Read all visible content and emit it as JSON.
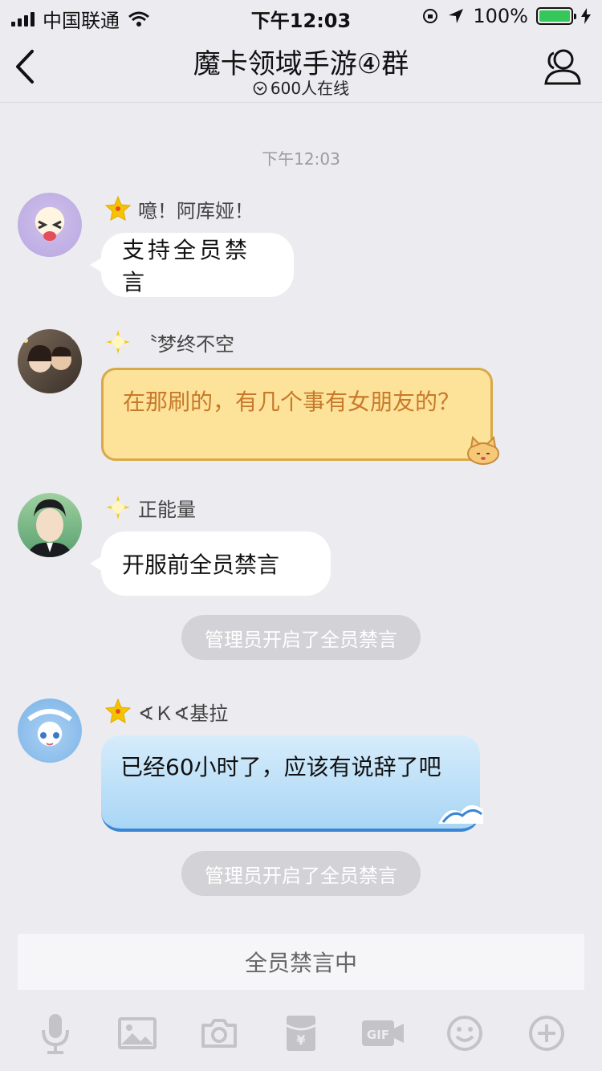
{
  "status": {
    "carrier": "中国联通",
    "time": "下午12:03",
    "battery": "100%"
  },
  "nav": {
    "title": "魔卡领域手游④群",
    "online": "600人在线"
  },
  "chat": {
    "time_label": "下午12:03",
    "messages": [
      {
        "nick": "噫！阿库娅！",
        "text": "支持全员禁言"
      },
      {
        "nick": "〝梦终不空",
        "text": "在那刷的，有几个事有女朋友的？"
      },
      {
        "nick": "正能量",
        "text": "开服前全员禁言"
      },
      {
        "nick": "∢Ｋ∢基拉",
        "text": "已经60小时了，应该有说辞了吧"
      }
    ],
    "system": [
      "管理员开启了全员禁言",
      "管理员开启了全员禁言"
    ]
  },
  "muted_label": "全员禁言中",
  "toolbar": [
    "mic",
    "image",
    "camera",
    "red-packet",
    "gif",
    "emoji",
    "plus"
  ],
  "colors": {
    "bg": "#ececf0",
    "gold": "#f5c400",
    "orange_text": "#c8792b",
    "blue_bubble": "#bfe1f6"
  }
}
